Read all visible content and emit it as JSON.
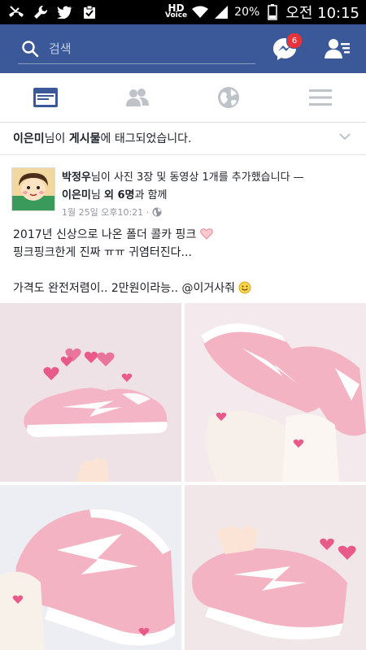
{
  "status_bar": {
    "hd_label": "HD",
    "voice_label": "Voice",
    "battery_percent": "20%",
    "time": "오전 10:15",
    "icons": [
      "missed-call-icon",
      "wrench-icon",
      "twitter-icon",
      "clipboard-check-icon",
      "wifi-icon",
      "signal-icon",
      "battery-icon"
    ]
  },
  "header": {
    "search_placeholder": "검색",
    "message_badge": "6",
    "colors": {
      "bar": "#3b5998",
      "badge": "#e8333a"
    }
  },
  "tabs": [
    "news-feed-icon",
    "friend-requests-icon",
    "notifications-globe-icon",
    "menu-icon"
  ],
  "notice": {
    "name": "이은미",
    "part1": "님이 ",
    "post_word": "게시물",
    "part2": "에 태그되었습니다."
  },
  "post": {
    "author": "박정우",
    "action": "님이 사진 3장 및 동영상 1개를 추가했습니다 —",
    "tagged_name": "이은미",
    "tagged_suffix": "님 ",
    "others": "외 6명",
    "with": "과 함께",
    "timestamp": "1월 25일 오후10:21 ·",
    "lines": {
      "l1": "2017년 신상으로 나온 폴더 콜카 핑크",
      "l2": "핑크핑크한게 진짜 ㅠㅠ 귀염터진다...",
      "l3": "가격도 완전저렴이.. 2만원이라능.. @이거사줘"
    }
  }
}
